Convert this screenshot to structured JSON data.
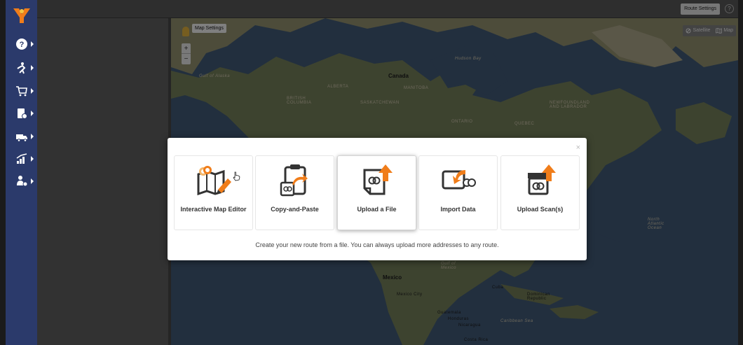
{
  "topbar": {
    "route_settings_label": "Route Settings",
    "help_label": "?"
  },
  "map": {
    "map_settings_label": "Map Settings",
    "zoom_in": "+",
    "zoom_out": "−",
    "type_satellite": "Satellite",
    "type_map": "Map",
    "labels": {
      "canada": "Canada",
      "mexico": "Mexico",
      "alberta": "ALBERTA",
      "manitoba": "MANITOBA",
      "saskatchewan": "SASKATCHEWAN",
      "british_columbia": "BRITISH COLUMBIA",
      "ontario": "ONTARIO",
      "quebec": "QUEBEC",
      "newfoundland": "NEWFOUNDLAND AND LABRADOR",
      "gulf_alaska": "Gulf of Alaska",
      "hudson_bay": "Hudson Bay",
      "cuba": "Cuba",
      "dominican_republic": "Dominican Republic",
      "guatemala": "Guatemala",
      "honduras": "Honduras",
      "nicaragua": "Nicaragua",
      "mexico_city": "Mexico City",
      "gulf_mexico": "Gulf of Mexico",
      "caribbean_sea": "Caribbean Sea",
      "costa_rica": "Costa Rica",
      "north_atlantic": "North Atlantic Ocean"
    }
  },
  "sidebar": {
    "items": [
      {
        "icon": "help-icon"
      },
      {
        "icon": "route-icon"
      },
      {
        "icon": "cart-icon"
      },
      {
        "icon": "address-book-icon"
      },
      {
        "icon": "truck-icon"
      },
      {
        "icon": "analytics-icon"
      },
      {
        "icon": "team-icon"
      }
    ]
  },
  "modal": {
    "close_label": "×",
    "options": [
      {
        "label": "Interactive Map Editor"
      },
      {
        "label": "Copy-and-Paste"
      },
      {
        "label": "Upload a File"
      },
      {
        "label": "Import Data"
      },
      {
        "label": "Upload Scan(s)"
      }
    ],
    "caption": "Create your new route from a file. You can always upload more addresses to any route."
  },
  "colors": {
    "sidebar": "#2b3a6b",
    "accent": "#f07d1a",
    "icon_dark": "#333333"
  }
}
